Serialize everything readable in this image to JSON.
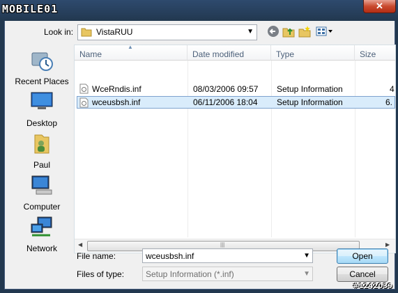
{
  "window": {
    "title": ""
  },
  "watermark_logo": "MOBILE01",
  "watermark_id": "#1242039",
  "toolbar": {
    "look_in_label": "Look in:",
    "look_in_value": "VistaRUU",
    "icons": [
      "back-icon",
      "up-folder-icon",
      "new-folder-icon",
      "views-menu-icon"
    ]
  },
  "places": [
    {
      "label": "Recent Places",
      "icon": "recent-places-icon"
    },
    {
      "label": "Desktop",
      "icon": "desktop-icon"
    },
    {
      "label": "Paul",
      "icon": "user-folder-icon"
    },
    {
      "label": "Computer",
      "icon": "computer-icon"
    },
    {
      "label": "Network",
      "icon": "network-icon"
    }
  ],
  "list": {
    "columns": [
      "Name",
      "Date modified",
      "Type",
      "Size"
    ],
    "sort_column": "Name",
    "rows": [
      {
        "name": "WceRndis.inf",
        "date": "08/03/2006 09:57",
        "type": "Setup Information",
        "size": "4",
        "selected": false
      },
      {
        "name": "wceusbsh.inf",
        "date": "06/11/2006 18:04",
        "type": "Setup Information",
        "size": "6.",
        "selected": true
      }
    ]
  },
  "form": {
    "file_name_label": "File name:",
    "file_name_value": "wceusbsh.inf",
    "file_type_label": "Files of type:",
    "file_type_value": "Setup Information (*.inf)"
  },
  "buttons": {
    "open": "Open",
    "cancel": "Cancel",
    "close": "✕"
  },
  "colors": {
    "selection": "#d9ecfb",
    "titlebar": "#22384f",
    "close": "#c94a2e"
  }
}
